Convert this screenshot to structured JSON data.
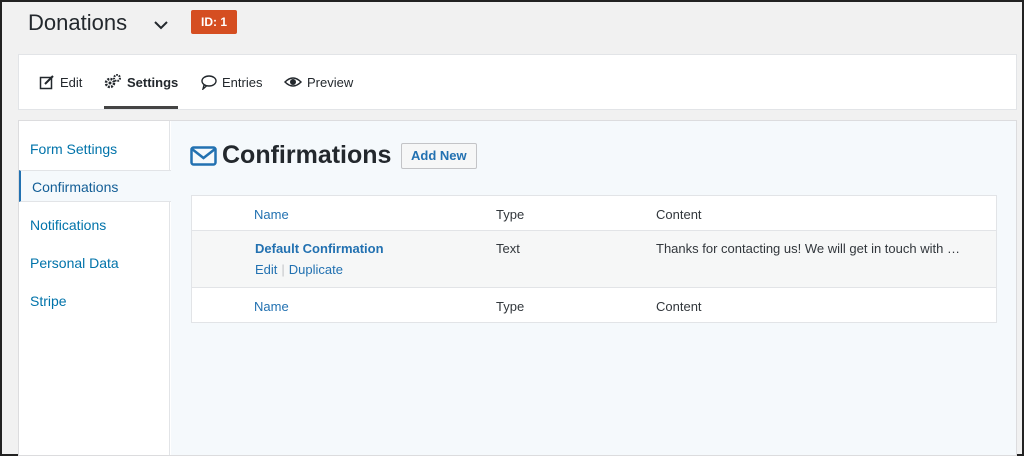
{
  "header": {
    "form_title": "Donations",
    "id_badge": "ID: 1"
  },
  "tabs": [
    {
      "label": "Edit",
      "icon": "edit-icon"
    },
    {
      "label": "Settings",
      "icon": "gears-icon",
      "active": true
    },
    {
      "label": "Entries",
      "icon": "speech-bubble-icon"
    },
    {
      "label": "Preview",
      "icon": "eye-icon"
    }
  ],
  "sidebar": {
    "items": [
      {
        "label": "Form Settings"
      },
      {
        "label": "Confirmations",
        "active": true
      },
      {
        "label": "Notifications"
      },
      {
        "label": "Personal Data"
      },
      {
        "label": "Stripe"
      }
    ]
  },
  "main": {
    "heading": "Confirmations",
    "heading_icon": "envelope-icon",
    "add_new_label": "Add New",
    "table": {
      "columns": [
        "Name",
        "Type",
        "Content"
      ],
      "rows": [
        {
          "name": "Default Confirmation",
          "type": "Text",
          "content": "Thanks for contacting us! We will get in touch with …",
          "actions": [
            "Edit",
            "Duplicate"
          ]
        }
      ],
      "footer_columns": [
        "Name",
        "Type",
        "Content"
      ]
    }
  },
  "colors": {
    "badge": "#d54e21",
    "link": "#2271b1",
    "panel_bg": "#f5f9fc"
  }
}
